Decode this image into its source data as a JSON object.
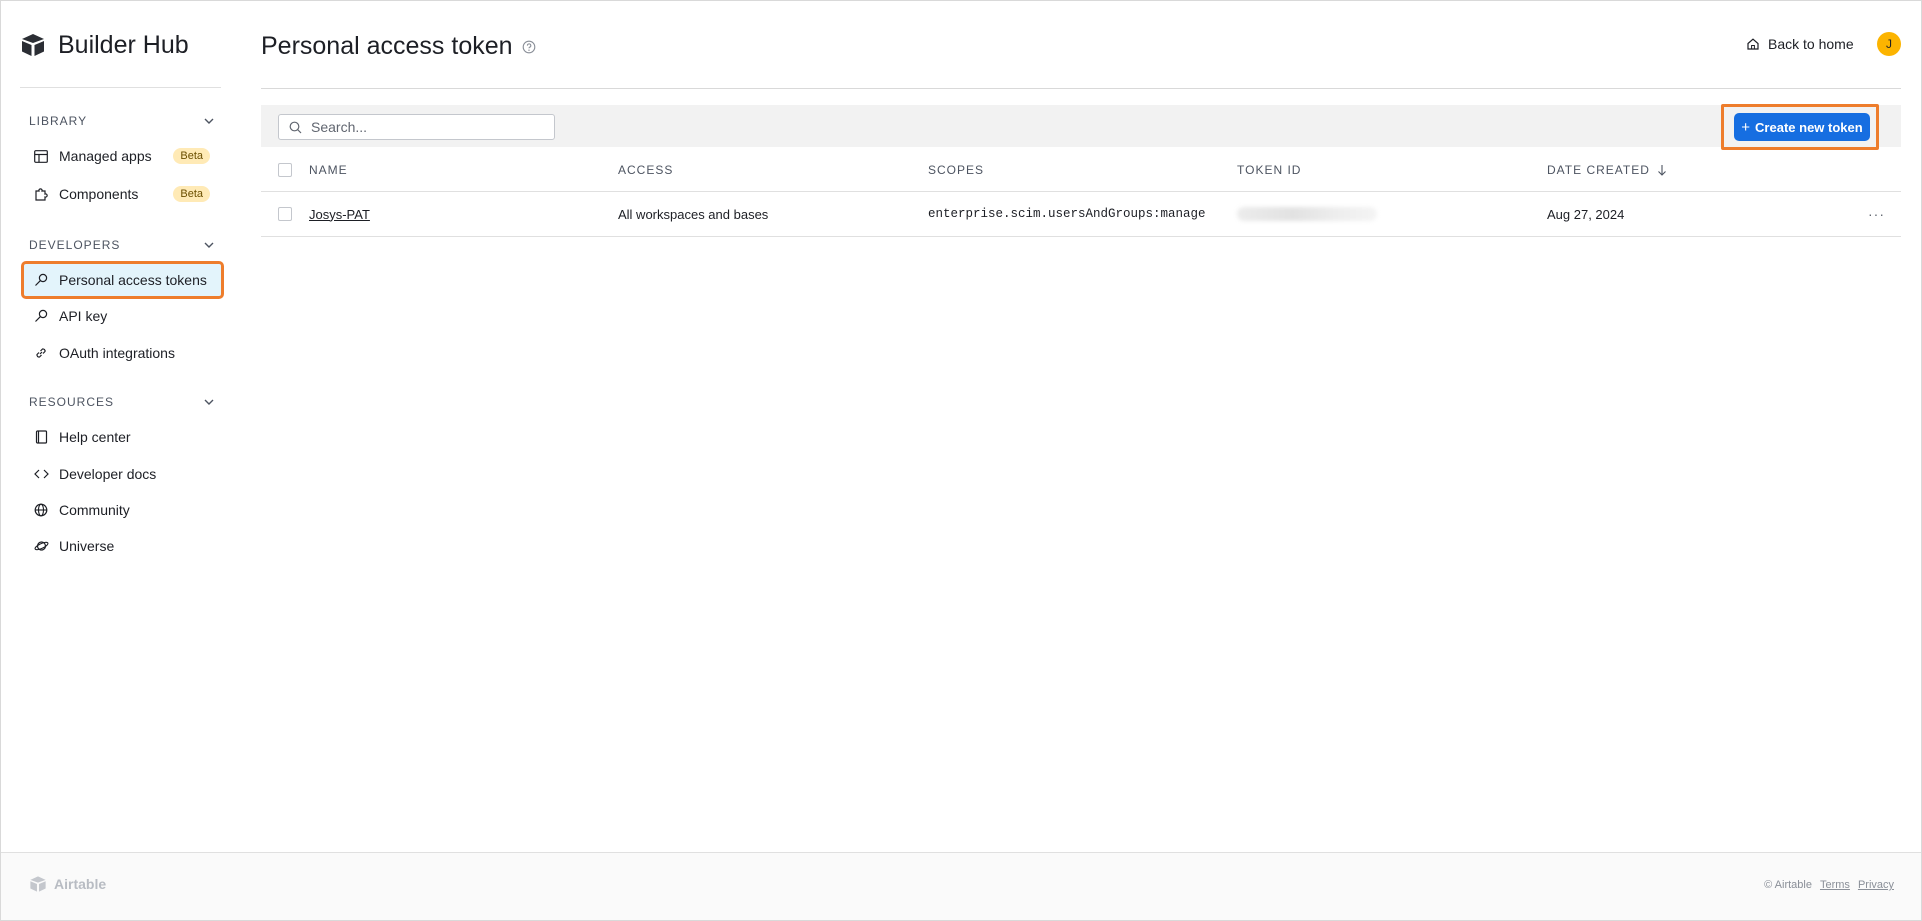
{
  "brand": {
    "name": "Builder Hub"
  },
  "sidebar": {
    "sections": [
      {
        "title": "LIBRARY",
        "items": [
          {
            "label": "Managed apps",
            "icon": "layout-icon",
            "badge": "Beta"
          },
          {
            "label": "Components",
            "icon": "puzzle-icon",
            "badge": "Beta"
          }
        ]
      },
      {
        "title": "DEVELOPERS",
        "items": [
          {
            "label": "Personal access tokens",
            "icon": "key-icon",
            "active": true
          },
          {
            "label": "API key",
            "icon": "key-icon"
          },
          {
            "label": "OAuth integrations",
            "icon": "link-icon"
          }
        ]
      },
      {
        "title": "RESOURCES",
        "items": [
          {
            "label": "Help center",
            "icon": "book-icon"
          },
          {
            "label": "Developer docs",
            "icon": "code-icon"
          },
          {
            "label": "Community",
            "icon": "globe-icon"
          },
          {
            "label": "Universe",
            "icon": "planet-icon"
          }
        ]
      }
    ]
  },
  "header": {
    "title": "Personal access token",
    "back_home": "Back to home",
    "avatar_initial": "J"
  },
  "toolbar": {
    "search_placeholder": "Search...",
    "create_label": "Create new token"
  },
  "table": {
    "columns": [
      "NAME",
      "ACCESS",
      "SCOPES",
      "TOKEN ID",
      "DATE CREATED"
    ],
    "rows": [
      {
        "name": "Josys-PAT",
        "access": "All workspaces and bases",
        "scopes": "enterprise.scim.usersAndGroups:manage",
        "token_id": "",
        "date_created": "Aug 27, 2024",
        "more": "···"
      }
    ]
  },
  "footer": {
    "logo": "Airtable",
    "copyright": "© Airtable",
    "links": [
      "Terms",
      "Privacy"
    ]
  },
  "colors": {
    "accent": "#166ee1",
    "highlight": "#ee7d2c",
    "active_bg": "#e3f4fb",
    "beta_bg": "#ffeab6",
    "avatar": "#fcb400"
  }
}
